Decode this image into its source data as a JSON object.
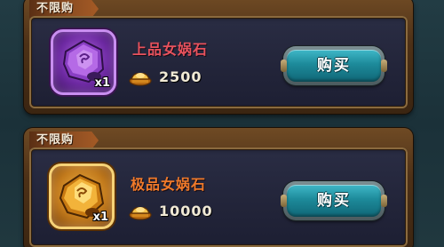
{
  "cards": [
    {
      "tag": "不限购",
      "item_name": "上品女娲石",
      "item_quantity": "x1",
      "price": "2500",
      "buy_label": "购买",
      "rarity": "purple",
      "name_color": "#e8525d"
    },
    {
      "tag": "不限购",
      "item_name": "极品女娲石",
      "item_quantity": "x1",
      "price": "10000",
      "buy_label": "购买",
      "rarity": "gold",
      "name_color": "#f07a2a"
    }
  ],
  "colors": {
    "button_teal": "#1d8a9a",
    "card_brown": "#4d3117",
    "panel_navy": "#222439"
  },
  "icons": {
    "item_icon": "nuwa-stone-icon",
    "currency_icon": "gold-ingot-icon"
  }
}
